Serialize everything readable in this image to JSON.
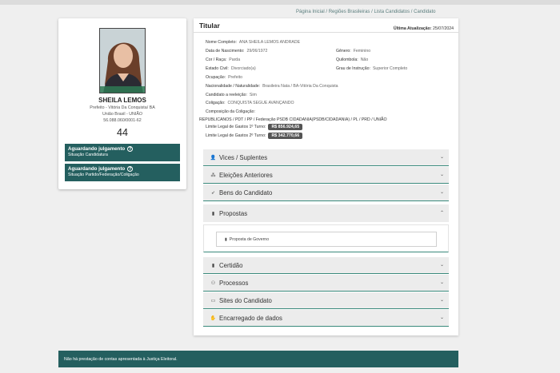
{
  "breadcrumb": [
    "Página Inicial",
    "Regiões Brasileiras",
    "Lista Candidatos",
    "Candidato"
  ],
  "candidate": {
    "name": "SHEILA LEMOS",
    "office": "Prefeito - Vitória Da Conquista/ BA",
    "coalition": "União Brasil - UNIÃO",
    "cnpj": "56.088.060/0001-62",
    "number": "44",
    "status1": {
      "title": "Aguardando julgamento",
      "subtitle": "Situação Candidatura"
    },
    "status2": {
      "title": "Aguardando julgamento",
      "subtitle": "Situação Partido/Federação/Coligação"
    }
  },
  "panel": {
    "title": "Titular",
    "update_label": "Última Atualização:",
    "update_date": "25/07/2024"
  },
  "fields": {
    "full_name": {
      "label": "Nome Completo:",
      "value": "ANA SHEILA LEMOS ANDRADE"
    },
    "birth": {
      "label": "Data de Nascimento:",
      "value": "29/06/1972"
    },
    "gender": {
      "label": "Gênero:",
      "value": "Feminino"
    },
    "race": {
      "label": "Cor / Raça:",
      "value": "Parda"
    },
    "quilombola": {
      "label": "Quilombola:",
      "value": "Não"
    },
    "civil": {
      "label": "Estado Civil:",
      "value": "Divorciado(a)"
    },
    "education": {
      "label": "Grau de Instrução:",
      "value": "Superior Completo"
    },
    "occupation": {
      "label": "Ocupação:",
      "value": "Prefeito"
    },
    "nationality": {
      "label": "Nacionalidade / Naturalidade:",
      "value": "Brasileira Nata / BA-Vitória Da Conquista"
    },
    "reelection": {
      "label": "Candidato a reeleição:",
      "value": "Sim"
    },
    "coalition": {
      "label": "Coligação:",
      "value": "CONQUISTA SEGUE AVANÇANDO"
    },
    "composition_label": "Composição da Coligação:",
    "composition_value": "REPUBLICANOS / PDT / PP / Federação PSDB CIDADANIA(PSDB/CIDADANIA) / PL / PRD / UNIÃO",
    "limit1": {
      "label": "Limite Legal de Gastos 1º Turno:",
      "value": "R$ 856.924,65"
    },
    "limit2": {
      "label": "Limite Legal de Gastos 2º Turno:",
      "value": "R$ 342.770,66"
    }
  },
  "sections": [
    {
      "label": "Vices / Suplentes",
      "icon": "person-icon"
    },
    {
      "label": "Eleições Anteriores",
      "icon": "sitemap-icon"
    },
    {
      "label": "Bens do Candidato",
      "icon": "rocket-icon"
    },
    {
      "label": "Propostas",
      "icon": "file-icon"
    },
    {
      "label": "Certidão",
      "icon": "file-icon"
    },
    {
      "label": "Processos",
      "icon": "group-icon"
    },
    {
      "label": "Sites do Candidato",
      "icon": "laptop-icon"
    },
    {
      "label": "Encarregado de dados",
      "icon": "handshake-icon"
    }
  ],
  "proposal_doc": "Proposta de Governo",
  "footer_note": "Não há prestação de contas apresentada à Justiça Eleitoral."
}
